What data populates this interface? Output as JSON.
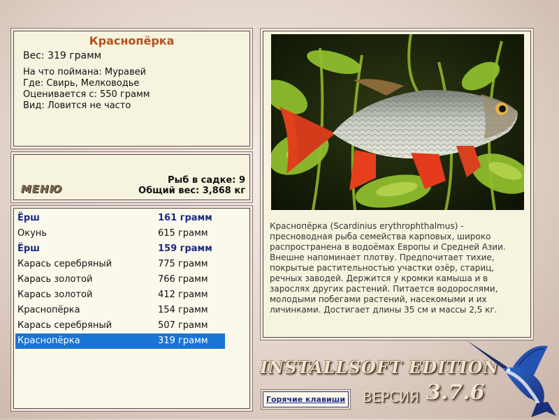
{
  "catch": {
    "title": "Краснопёрка",
    "weight": "Вес: 319 грамм",
    "bait": "На что поймана: Муравей",
    "place": "Где: Свирь, Мелководье",
    "valued": "Оценивается с: 550 грамм",
    "species": "Вид: Ловится не часто"
  },
  "menu": {
    "label": "МЕНЮ",
    "keep_count": "Рыб в садке: 9",
    "total_weight": "Общий вес: 3,868 кг"
  },
  "fish_list": [
    {
      "name": "Ёрш",
      "weight": "161 грамм",
      "style": "bold"
    },
    {
      "name": "Окунь",
      "weight": "615 грамм",
      "style": "normal"
    },
    {
      "name": "Ёрш",
      "weight": "159 грамм",
      "style": "bold"
    },
    {
      "name": "Карась серебряный",
      "weight": "775 грамм",
      "style": "normal"
    },
    {
      "name": "Карась золотой",
      "weight": "766 грамм",
      "style": "normal"
    },
    {
      "name": "Карась золотой",
      "weight": "412 грамм",
      "style": "normal"
    },
    {
      "name": "Краснопёрка",
      "weight": "154 грамм",
      "style": "normal"
    },
    {
      "name": "Карась серебряный",
      "weight": "507 грамм",
      "style": "normal"
    },
    {
      "name": "Краснопёрка",
      "weight": "319 грамм",
      "style": "selected"
    }
  ],
  "info": {
    "description": "Краснопёрка (Scardinius erythrophthalmus) - пресноводная рыба семейства карповых, широко распространена в водоёмах Европы и Средней Азии. Внешне напоминает плотву. Предпочитает тихие, покрытые растительностью участки озёр, стариц, речных заводей. Держится у кромки камыша и в зарослях других растений. Питается водорослями, молодыми побегами растений, насекомыми и их личинками. Достигает длины 35 см и массы 2,5 кг."
  },
  "footer": {
    "edition": "INSTALLSOFT EDITION",
    "version_label": "ВЕРСИЯ",
    "version_number": "3.7.6",
    "hotkeys": "Горячие клавиши"
  },
  "colors": {
    "title": "#b5521c",
    "bold_row": "#1c2a85",
    "selected_row": "#1a74d4",
    "panel_bg": "#f6f3df"
  },
  "icons": [
    "fish-photo",
    "marlin-logo-icon"
  ]
}
